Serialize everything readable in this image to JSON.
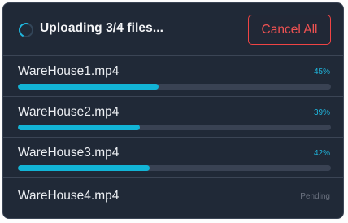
{
  "upload": {
    "title": "Uploading 3/4 files...",
    "cancel_label": "Cancel All",
    "accent": "#12b4d6",
    "cancel_color": "#ef4444",
    "files": [
      {
        "name": "WareHouse1.mp4",
        "status": "45%",
        "progress": 0.45
      },
      {
        "name": "WareHouse2.mp4",
        "status": "39%",
        "progress": 0.39
      },
      {
        "name": "WareHouse3.mp4",
        "status": "42%",
        "progress": 0.42
      },
      {
        "name": "WareHouse4.mp4",
        "status": "Pending",
        "progress": null
      }
    ]
  },
  "icons": {
    "spinner": "loading-spinner-icon"
  }
}
